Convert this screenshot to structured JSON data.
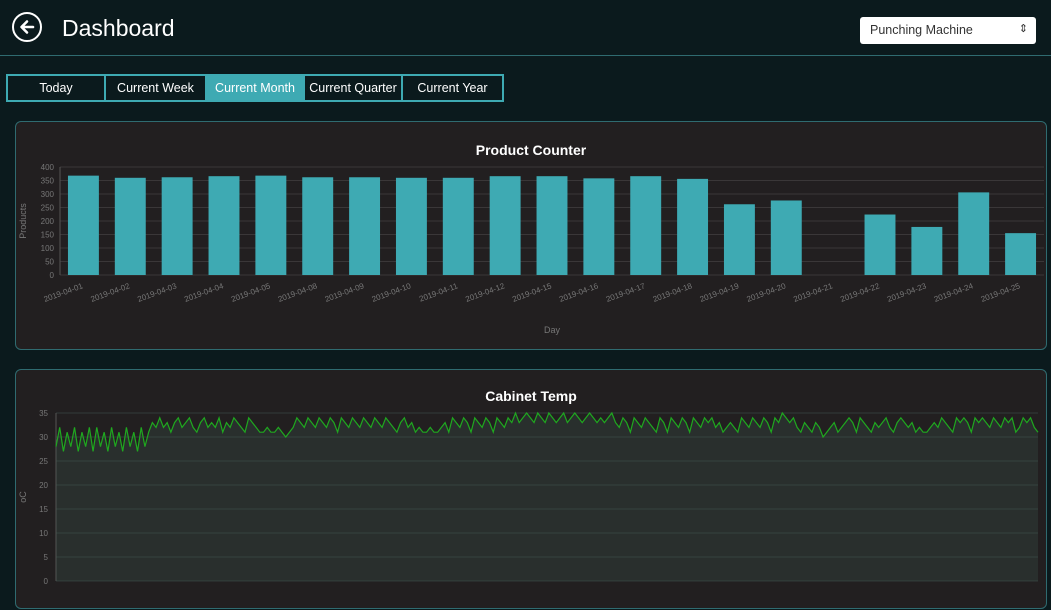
{
  "header": {
    "title": "Dashboard",
    "machine_select": {
      "value": "Punching Machine",
      "options": [
        "Punching Machine"
      ]
    }
  },
  "tabs": [
    {
      "label": "Today",
      "active": false
    },
    {
      "label": "Current Week",
      "active": false
    },
    {
      "label": "Current Month",
      "active": true
    },
    {
      "label": "Current Quarter",
      "active": false
    },
    {
      "label": "Current Year",
      "active": false
    }
  ],
  "colors": {
    "accent": "#3eaab3",
    "background": "#0b1a1d",
    "card": "#221f20",
    "temp_line": "#1fa81f"
  },
  "chart_data": [
    {
      "type": "bar",
      "title": "Product Counter",
      "xlabel": "Day",
      "ylabel": "Products",
      "ylim": [
        0,
        400
      ],
      "yticks": [
        0,
        50,
        100,
        150,
        200,
        250,
        300,
        350,
        400
      ],
      "categories": [
        "2019-04-01",
        "2019-04-02",
        "2019-04-03",
        "2019-04-04",
        "2019-04-05",
        "2019-04-08",
        "2019-04-09",
        "2019-04-10",
        "2019-04-11",
        "2019-04-12",
        "2019-04-15",
        "2019-04-16",
        "2019-04-17",
        "2019-04-18",
        "2019-04-19",
        "2019-04-20",
        "2019-04-21",
        "2019-04-22",
        "2019-04-23",
        "2019-04-24",
        "2019-04-25"
      ],
      "values": [
        368,
        360,
        362,
        366,
        368,
        362,
        362,
        360,
        360,
        366,
        366,
        358,
        366,
        356,
        262,
        276,
        0,
        224,
        178,
        306,
        155
      ],
      "color": "#3eaab3",
      "grid": true
    },
    {
      "type": "line",
      "title": "Cabinet Temp",
      "xlabel": "",
      "ylabel": "oC",
      "ylim": [
        0,
        35
      ],
      "yticks": [
        0,
        5,
        10,
        15,
        20,
        25,
        30,
        35
      ],
      "series": [
        {
          "values": [
            28,
            32,
            27,
            31,
            28,
            32,
            27,
            31,
            28,
            32,
            27,
            32,
            28,
            31,
            27,
            32,
            28,
            31,
            27,
            32,
            28,
            31,
            27,
            32,
            28,
            31,
            33,
            32,
            34,
            32,
            33,
            31,
            33,
            34,
            32,
            33,
            34,
            32,
            31,
            33,
            34,
            32,
            33,
            32,
            34,
            31,
            33,
            32,
            34,
            33,
            32,
            31,
            34,
            33,
            32,
            31,
            31,
            32,
            31,
            31,
            32,
            31,
            30,
            31,
            32,
            34,
            33,
            32,
            34,
            33,
            32,
            34,
            33,
            32,
            34,
            33,
            31,
            34,
            33,
            32,
            34,
            33,
            32,
            34,
            33,
            32,
            34,
            33,
            32,
            34,
            33,
            32,
            31,
            33,
            34,
            32,
            33,
            31,
            32,
            31,
            31,
            32,
            31,
            31,
            32,
            33,
            31,
            34,
            33,
            32,
            34,
            33,
            31,
            34,
            33,
            32,
            34,
            33,
            31,
            34,
            33,
            32,
            34,
            33,
            35,
            33,
            34,
            35,
            34,
            33,
            35,
            34,
            33,
            35,
            34,
            33,
            34,
            35,
            33,
            34,
            35,
            34,
            33,
            34,
            35,
            34,
            33,
            34,
            33,
            34,
            35,
            33,
            32,
            34,
            33,
            31,
            34,
            33,
            32,
            34,
            33,
            32,
            31,
            34,
            33,
            31,
            34,
            33,
            32,
            34,
            33,
            31,
            34,
            33,
            32,
            34,
            33,
            34,
            32,
            33,
            31,
            32,
            33,
            32,
            31,
            34,
            33,
            32,
            34,
            33,
            32,
            34,
            33,
            31,
            34,
            33,
            35,
            34,
            33,
            34,
            32,
            31,
            33,
            32,
            31,
            33,
            32,
            30,
            31,
            32,
            33,
            31,
            32,
            33,
            34,
            33,
            31,
            34,
            33,
            32,
            31,
            33,
            32,
            33,
            34,
            32,
            31,
            33,
            34,
            33,
            32,
            33,
            31,
            32,
            31,
            31,
            32,
            33,
            32,
            34,
            33,
            32,
            31,
            34,
            33,
            34,
            33,
            31,
            34,
            33,
            34,
            33,
            32,
            34,
            33,
            32,
            34,
            33,
            34,
            31,
            32,
            34,
            33,
            34,
            32,
            31
          ]
        }
      ],
      "grid": true
    }
  ]
}
